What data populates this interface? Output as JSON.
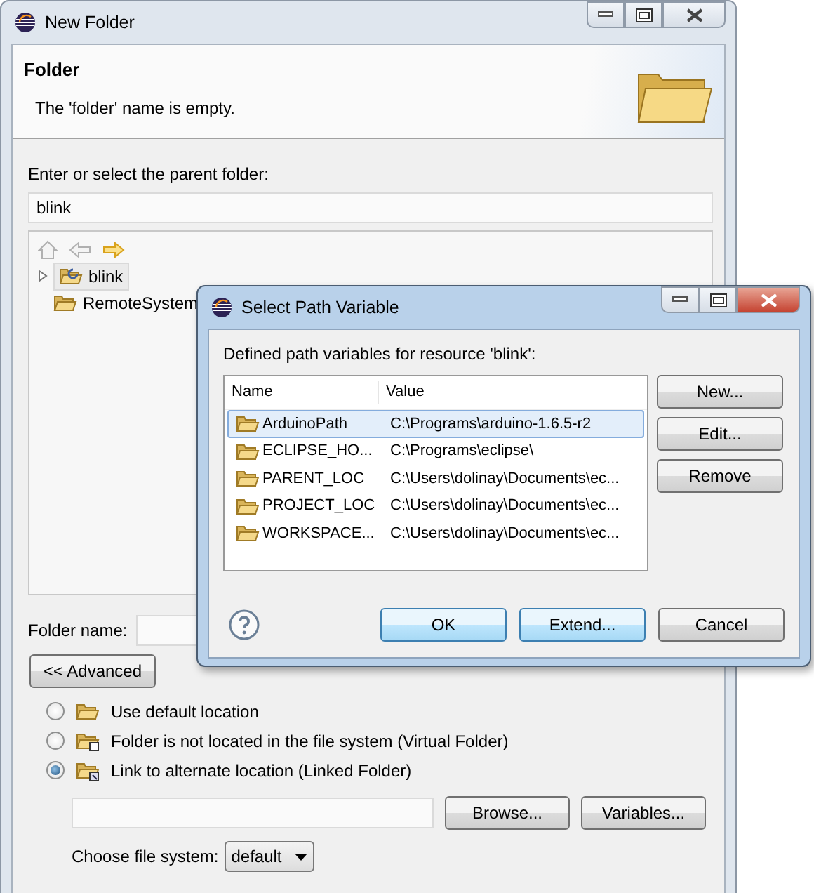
{
  "window": {
    "title": "New Folder"
  },
  "header": {
    "title": "Folder",
    "message": "The 'folder' name is empty."
  },
  "parent_folder": {
    "label": "Enter or select the parent folder:",
    "value": "blink"
  },
  "nav_buttons": [
    {
      "kind": "home",
      "disabled": true
    },
    {
      "kind": "back",
      "disabled": true
    },
    {
      "kind": "forward",
      "disabled": false
    }
  ],
  "tree": {
    "items": [
      {
        "label": "blink",
        "selected": true,
        "expandable": true,
        "kind": "project"
      },
      {
        "label": "RemoteSystem",
        "selected": false,
        "expandable": false,
        "kind": "folder"
      }
    ]
  },
  "folder_name": {
    "label": "Folder name:"
  },
  "advanced_button": "<< Advanced",
  "location_options": [
    {
      "label": "Use default location",
      "selected": false,
      "kind": "default"
    },
    {
      "label": "Folder is not located in the file system (Virtual Folder)",
      "selected": false,
      "kind": "virtual"
    },
    {
      "label": "Link to alternate location (Linked Folder)",
      "selected": true,
      "kind": "linked"
    }
  ],
  "link_buttons": [
    "Browse...",
    "Variables..."
  ],
  "file_system": {
    "label": "Choose file system:",
    "value": "default"
  },
  "dialog": {
    "title": "Select Path Variable",
    "label": "Defined path variables for resource 'blink':",
    "columns": [
      "Name",
      "Value"
    ],
    "rows": [
      {
        "name": "ArduinoPath",
        "value": "C:\\Programs\\arduino-1.6.5-r2",
        "selected": true
      },
      {
        "name": "ECLIPSE_HO...",
        "value": "C:\\Programs\\eclipse\\",
        "selected": false
      },
      {
        "name": "PARENT_LOC",
        "value": "C:\\Users\\dolinay\\Documents\\ec...",
        "selected": false
      },
      {
        "name": "PROJECT_LOC",
        "value": "C:\\Users\\dolinay\\Documents\\ec...",
        "selected": false
      },
      {
        "name": "WORKSPACE...",
        "value": "C:\\Users\\dolinay\\Documents\\ec...",
        "selected": false
      }
    ],
    "side_buttons": [
      "New...",
      "Edit...",
      "Remove"
    ],
    "buttons": [
      {
        "label": "OK",
        "highlighted": true
      },
      {
        "label": "Extend...",
        "highlighted": true
      },
      {
        "label": "Cancel",
        "highlighted": false
      }
    ]
  }
}
